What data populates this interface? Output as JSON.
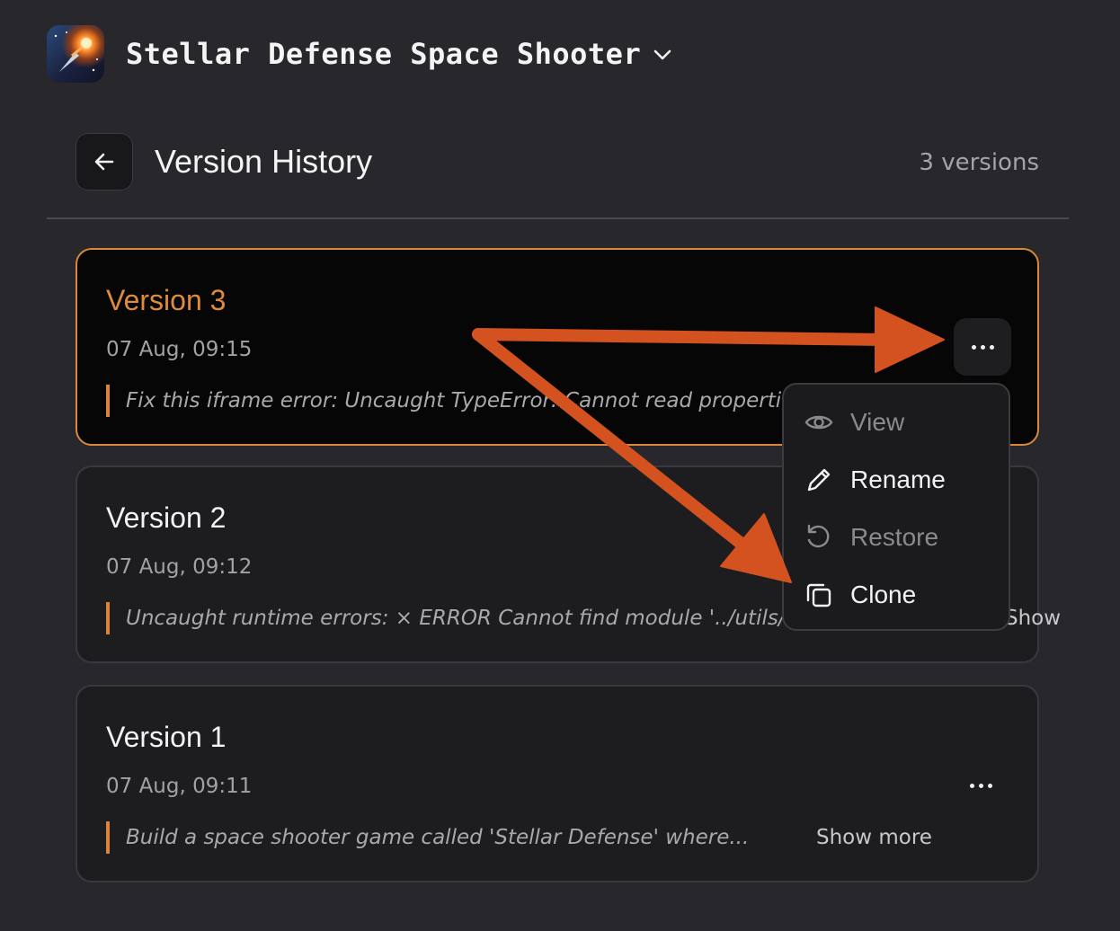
{
  "header": {
    "project_title": "Stellar Defense Space Shooter",
    "app_icon": "spaceship-game-icon",
    "dropdown_icon": "chevron-down-icon"
  },
  "page": {
    "title": "Version History",
    "version_count": "3 versions",
    "back_icon": "arrow-left-icon"
  },
  "versions": [
    {
      "title": "Version 3",
      "date": "07 Aug, 09:15",
      "prompt": "Fix this iframe error: Uncaught TypeError: Cannot read propertie",
      "active": true
    },
    {
      "title": "Version 2",
      "date": "07 Aug, 09:12",
      "prompt": "Uncaught runtime errors: × ERROR Cannot find module '../utils/S",
      "show_more": "Show"
    },
    {
      "title": "Version 1",
      "date": "07 Aug, 09:11",
      "prompt": "Build a space shooter game called 'Stellar Defense' where...",
      "show_more": "Show more"
    }
  ],
  "menu": {
    "items": [
      {
        "label": "View",
        "icon": "eye-icon",
        "enabled": false
      },
      {
        "label": "Rename",
        "icon": "pencil-icon",
        "enabled": true
      },
      {
        "label": "Restore",
        "icon": "restore-icon",
        "enabled": false
      },
      {
        "label": "Clone",
        "icon": "copy-icon",
        "enabled": true
      }
    ]
  },
  "colors": {
    "background": "#28282c",
    "accent": "#d9883a",
    "annotation_arrow": "#d4521f",
    "card": "#1d1d20",
    "active_card": "#060606"
  }
}
